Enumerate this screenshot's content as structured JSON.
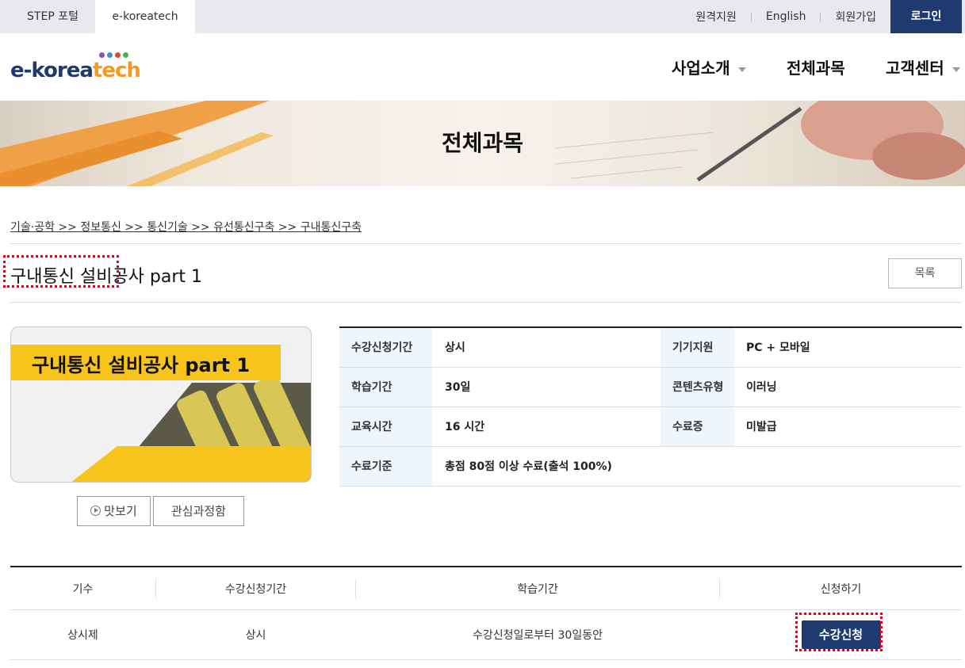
{
  "topbar": {
    "tabs": [
      "STEP 포털",
      "e-koreatech"
    ],
    "links": [
      "원격지원",
      "English",
      "회원가입"
    ],
    "login": "로그인"
  },
  "header": {
    "logo_text_a": "e-korea",
    "logo_text_b": "tech",
    "logo_dot_colors": [
      "#8a4fb5",
      "#3b8fd6",
      "#e3462e",
      "#4bb24a"
    ],
    "nav": [
      "사업소개",
      "전체과목",
      "고객센터"
    ]
  },
  "banner": {
    "title": "전체과목"
  },
  "breadcrumb": "기술·공학 >> 정보통신 >> 통신기술 >> 유선통신구축 >> 구내통신구축",
  "course": {
    "title": "구내통신 설비공사 part 1",
    "list_button": "목록",
    "thumbnail_caption": "구내통신 설비공사 part 1",
    "preview_button": "맛보기",
    "favorite_button": "관심과정함"
  },
  "info": {
    "rows": [
      {
        "k1": "수강신청기간",
        "v1": "상시",
        "k2": "기기지원",
        "v2": "PC + 모바일"
      },
      {
        "k1": "학습기간",
        "v1": "30일",
        "k2": "콘텐츠유형",
        "v2": "이러닝"
      },
      {
        "k1": "교육시간",
        "v1": "16 시간",
        "k2": "수료증",
        "v2": "미발급"
      },
      {
        "k1": "수료기준",
        "v1": "총점 80점 이상 수료(출석 100%)"
      }
    ]
  },
  "schedule": {
    "headers": [
      "기수",
      "수강신청기간",
      "학습기간",
      "신청하기"
    ],
    "row": [
      "상시제",
      "상시",
      "수강신청일로부터 30일동안"
    ],
    "apply_button": "수강신청"
  },
  "colors": {
    "brand_navy": "#1e3a6e",
    "brand_orange": "#f39a1f",
    "highlight_red": "#e0001a",
    "table_header_bg": "#eef6fb"
  }
}
